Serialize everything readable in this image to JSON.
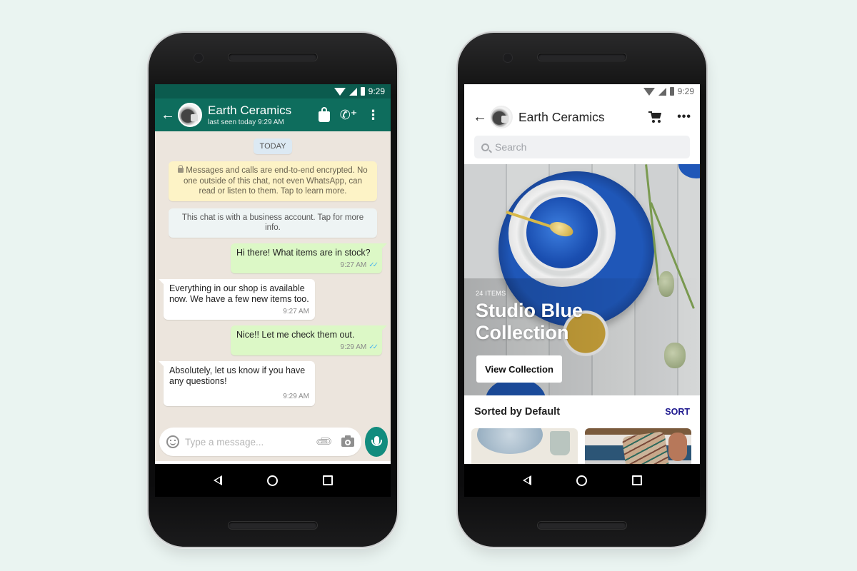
{
  "chat_phone": {
    "status": {
      "time": "9:29"
    },
    "header": {
      "contact_name": "Earth Ceramics",
      "last_seen": "last seen today 9:29 AM",
      "icons": [
        "back-arrow-icon",
        "catalog-bag-icon",
        "add-call-icon",
        "more-vert-icon"
      ]
    },
    "date_chip": "TODAY",
    "encryption_notice": "Messages and calls are end-to-end encrypted. No one outside of this chat, not even WhatsApp, can read or listen to them. Tap to learn more.",
    "business_notice": "This chat is with a business account. Tap for more info.",
    "messages": [
      {
        "direction": "out",
        "text": "Hi there! What items are in stock?",
        "time": "9:27 AM",
        "ticks": "✓✓"
      },
      {
        "direction": "in",
        "text": "Everything in our shop is available now. We have a few new items too.",
        "time": "9:27 AM"
      },
      {
        "direction": "out",
        "text": "Nice!! Let me check them out.",
        "time": "9:29 AM",
        "ticks": "✓✓"
      },
      {
        "direction": "in",
        "text": "Absolutely, let us know if you have any questions!",
        "time": "9:29 AM"
      }
    ],
    "composer": {
      "placeholder": "Type a message...",
      "value": ""
    },
    "colors": {
      "header": "#0e6d5d",
      "status_bar": "#0b5b4e",
      "outgoing_bubble": "#dcf8c6",
      "chat_bg": "#ece5dd",
      "mic_button": "#128c7e",
      "read_ticks": "#4fb6ec"
    }
  },
  "catalog_phone": {
    "status": {
      "time": "9:29"
    },
    "header": {
      "title": "Earth Ceramics",
      "icons": [
        "back-arrow-icon",
        "cart-icon",
        "more-horiz-icon"
      ]
    },
    "search": {
      "placeholder": "Search",
      "value": ""
    },
    "hero": {
      "item_count": "24 ITEMS",
      "title_line1": "Studio Blue",
      "title_line2": "Collection",
      "button": "View Collection"
    },
    "sort": {
      "label": "Sorted by Default",
      "action": "SORT"
    },
    "colors": {
      "sort_link": "#1f1a8f",
      "plate_blue": "#1f57b8"
    }
  },
  "nav": {
    "back": "back-triangle-icon",
    "home": "home-circle-icon",
    "recents": "recents-square-icon"
  }
}
